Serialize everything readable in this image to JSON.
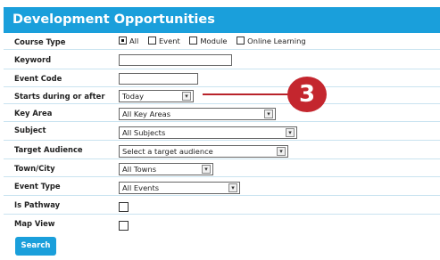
{
  "header": {
    "title": "Development Opportunities"
  },
  "form": {
    "course_type": {
      "label": "Course Type",
      "options": [
        {
          "label": "All",
          "checked": true
        },
        {
          "label": "Event",
          "checked": false
        },
        {
          "label": "Module",
          "checked": false
        },
        {
          "label": "Online Learning",
          "checked": false
        }
      ]
    },
    "keyword": {
      "label": "Keyword",
      "value": ""
    },
    "event_code": {
      "label": "Event Code",
      "value": ""
    },
    "starts": {
      "label": "Starts during or after",
      "value": "Today"
    },
    "key_area": {
      "label": "Key Area",
      "value": "All Key Areas"
    },
    "subject": {
      "label": "Subject",
      "value": "All Subjects"
    },
    "target_audience": {
      "label": "Target Audience",
      "value": "Select a target audience"
    },
    "town_city": {
      "label": "Town/City",
      "value": "All Towns"
    },
    "event_type": {
      "label": "Event Type",
      "value": "All Events"
    },
    "is_pathway": {
      "label": "Is Pathway",
      "checked": false
    },
    "map_view": {
      "label": "Map View",
      "checked": false
    },
    "search_button": "Search"
  },
  "callout": {
    "number": "3",
    "color": "#c4262e"
  },
  "colors": {
    "header": "#1a9fdb",
    "button": "#1a9fdb"
  }
}
